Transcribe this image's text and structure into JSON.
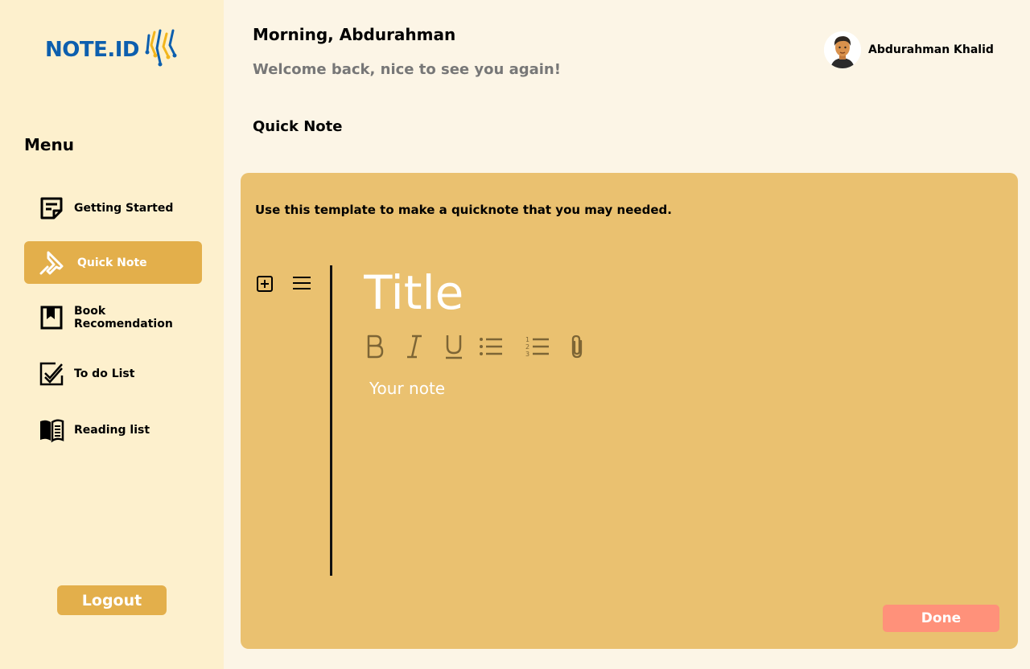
{
  "app": {
    "logo_text": "NOTE.ID",
    "brand_color": "#0d5fae",
    "accent_color": "#e3af4b"
  },
  "sidebar": {
    "menu_title": "Menu",
    "items": [
      {
        "label": "Getting Started",
        "icon": "sticky-note-icon",
        "active": false
      },
      {
        "label": "Quick Note",
        "icon": "pin-icon",
        "active": true
      },
      {
        "label": "Book Recomendation",
        "icon": "bookmark-book-icon",
        "active": false
      },
      {
        "label": "To do List",
        "icon": "checklist-icon",
        "active": false
      },
      {
        "label": "Reading list",
        "icon": "open-book-icon",
        "active": false
      }
    ],
    "logout_label": "Logout"
  },
  "header": {
    "greeting": "Morning, Abdurahman",
    "welcome": "Welcome back, nice to see you again!",
    "user_name": "Abdurahman Khalid"
  },
  "main": {
    "section_title": "Quick Note",
    "instructions": "Use this template to make a quicknote that you may needed.",
    "title_placeholder": "Title",
    "note_placeholder": "Your note",
    "toolbar": [
      {
        "name": "bold-button",
        "icon": "bold-icon"
      },
      {
        "name": "italic-button",
        "icon": "italic-icon"
      },
      {
        "name": "underline-button",
        "icon": "underline-icon"
      },
      {
        "name": "bullet-list-button",
        "icon": "bullet-list-icon"
      },
      {
        "name": "numbered-list-button",
        "icon": "numbered-list-icon"
      },
      {
        "name": "attach-button",
        "icon": "paperclip-icon"
      }
    ],
    "done_label": "Done",
    "done_color": "#ff917a"
  }
}
